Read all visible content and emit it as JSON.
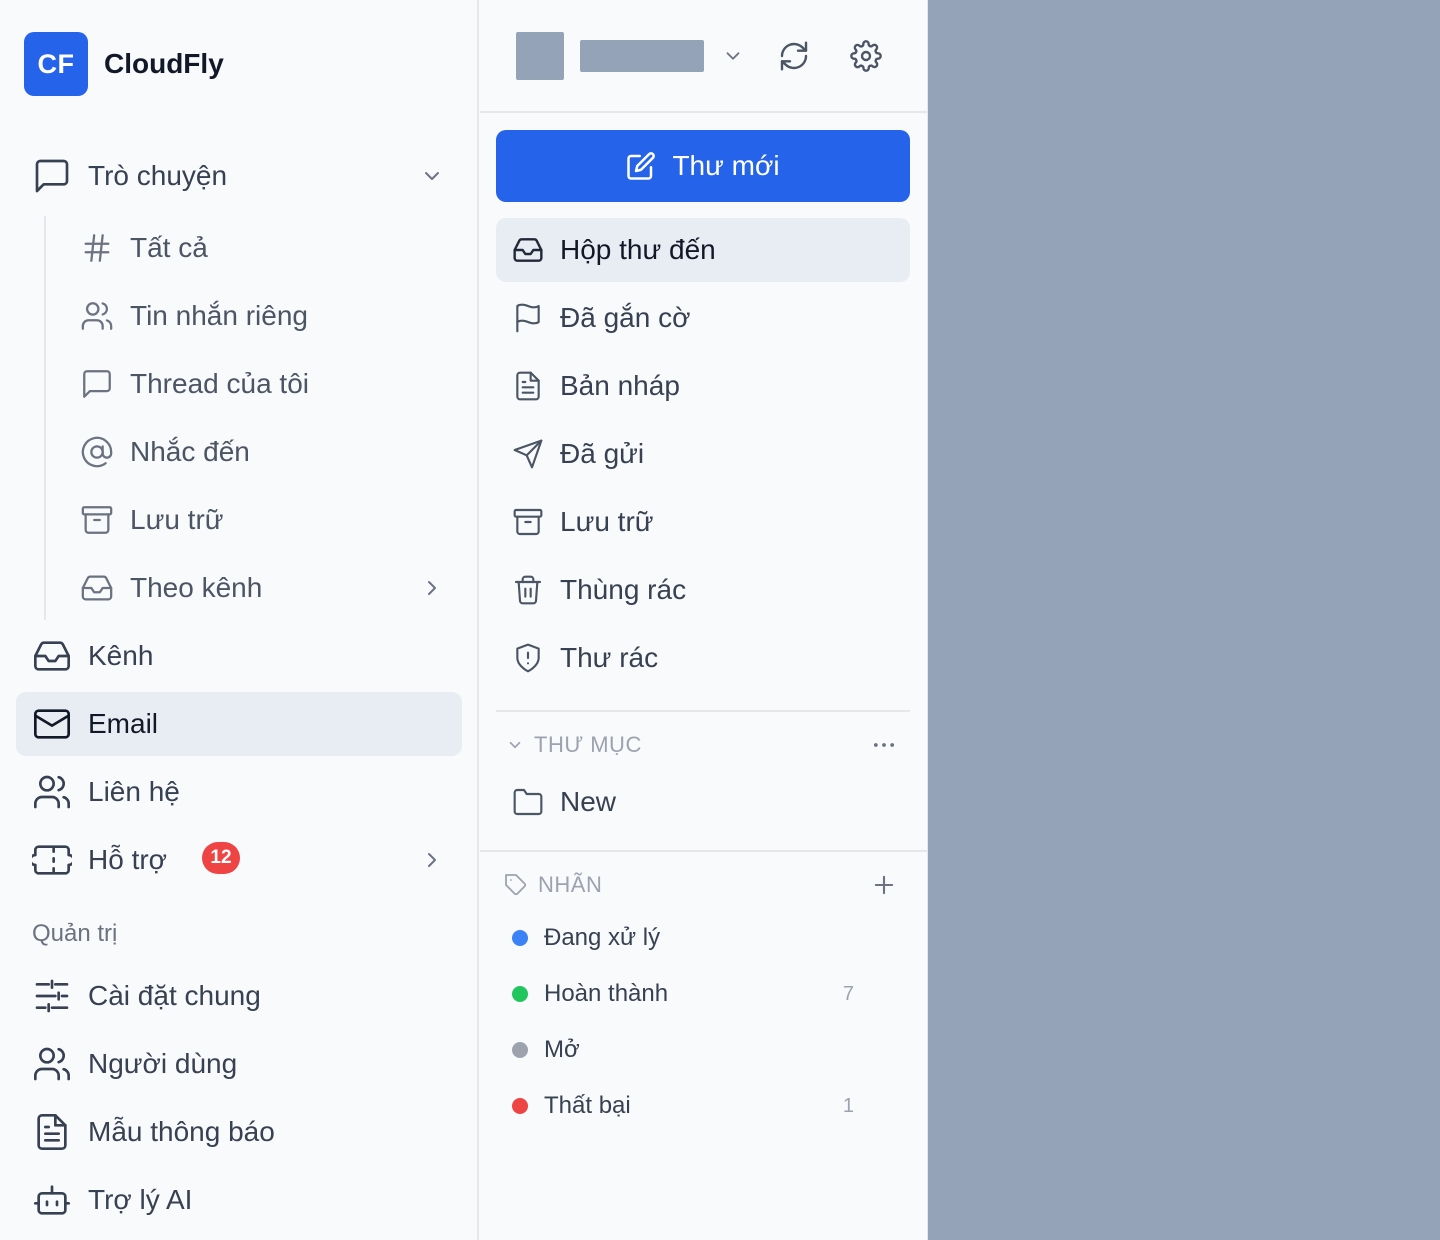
{
  "brand": {
    "logo": "CF",
    "name": "CloudFly",
    "logo_color": "#2563eb"
  },
  "sidebar": {
    "chat": {
      "label": "Trò chuyện",
      "icon": "message-square-icon"
    },
    "chat_items": [
      {
        "label": "Tất cả",
        "icon": "hash-icon"
      },
      {
        "label": "Tin nhắn riêng",
        "icon": "users-icon"
      },
      {
        "label": "Thread của tôi",
        "icon": "message-square-icon"
      },
      {
        "label": "Nhắc đến",
        "icon": "at-sign-icon"
      },
      {
        "label": "Lưu trữ",
        "icon": "archive-icon"
      },
      {
        "label": "Theo kênh",
        "icon": "inbox-icon"
      }
    ],
    "items": [
      {
        "label": "Kênh",
        "icon": "inbox-icon"
      },
      {
        "label": "Email",
        "icon": "mail-icon",
        "active": true
      },
      {
        "label": "Liên hệ",
        "icon": "users-icon"
      },
      {
        "label": "Hỗ trợ",
        "icon": "ticket-icon",
        "badge": "12"
      }
    ],
    "admin_title": "Quản trị",
    "admin_items": [
      {
        "label": "Cài đặt chung",
        "icon": "sliders-icon"
      },
      {
        "label": "Người dùng",
        "icon": "users-icon"
      },
      {
        "label": "Mẫu thông báo",
        "icon": "file-text-icon"
      },
      {
        "label": "Trợ lý AI",
        "icon": "bot-icon"
      }
    ]
  },
  "mail": {
    "compose_label": "Thư mới",
    "folders": [
      {
        "label": "Hộp thư đến",
        "icon": "inbox-icon",
        "active": true
      },
      {
        "label": "Đã gắn cờ",
        "icon": "flag-icon"
      },
      {
        "label": "Bản nháp",
        "icon": "file-text-icon"
      },
      {
        "label": "Đã gửi",
        "icon": "send-icon"
      },
      {
        "label": "Lưu trữ",
        "icon": "archive-icon"
      },
      {
        "label": "Thùng rác",
        "icon": "trash-icon"
      },
      {
        "label": "Thư rác",
        "icon": "shield-alert-icon"
      }
    ],
    "directory_title": "THƯ MỤC",
    "directories": [
      {
        "label": "New",
        "icon": "folder-icon"
      }
    ],
    "labels_title": "NHÃN",
    "labels": [
      {
        "label": "Đang xử lý",
        "color": "#3b82f6",
        "count": ""
      },
      {
        "label": "Hoàn thành",
        "color": "#22c55e",
        "count": "7"
      },
      {
        "label": "Mở",
        "color": "#9ca3af",
        "count": ""
      },
      {
        "label": "Thất bại",
        "color": "#ef4444",
        "count": "1"
      }
    ]
  },
  "colors": {
    "accent": "#2563eb",
    "badge": "#ef4444",
    "overlay": "#94a3b8"
  }
}
